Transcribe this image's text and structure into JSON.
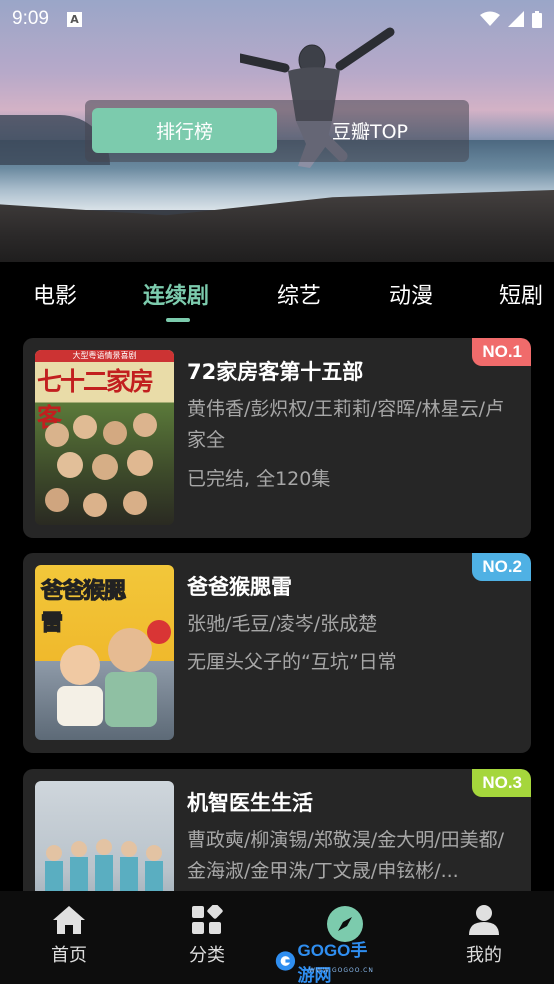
{
  "status_bar": {
    "time": "9:09",
    "notif_icon": "A"
  },
  "segments": {
    "active": "排行榜",
    "other": "豆瓣TOP"
  },
  "tabs": [
    "电影",
    "连续剧",
    "综艺",
    "动漫",
    "短剧"
  ],
  "active_tab_index": 1,
  "items": [
    {
      "rank": "NO.1",
      "badge_color": "#f06b6b",
      "title": "72家房客第十五部",
      "cast": "黄伟香/彭炽权/王莉莉/容晖/林星云/卢家全",
      "desc": "已完结, 全120集",
      "poster_title": "七十二家房客",
      "poster_top": "大型粤语情景喜剧"
    },
    {
      "rank": "NO.2",
      "badge_color": "#4fb1e4",
      "title": "爸爸猴腮雷",
      "cast": "张驰/毛豆/凌岑/张成楚",
      "desc": "无厘头父子的“互坑”日常",
      "poster_title": "爸爸猴腮雷"
    },
    {
      "rank": "NO.3",
      "badge_color": "#a5d63c",
      "title": "机智医生生活",
      "cast": "曹政奭/柳演锡/郑敬淏/金大明/田美都/金海淑/金甲洙/丁文晟/申铉彬/..."
    }
  ],
  "nav": [
    {
      "label": "首页",
      "icon": "home-icon"
    },
    {
      "label": "分类",
      "icon": "category-icon"
    },
    {
      "label": "",
      "icon": "compass-icon"
    },
    {
      "label": "我的",
      "icon": "user-icon"
    }
  ],
  "watermark": {
    "text": "GOGO手游网",
    "sub": "WWW.GOGOO.CN"
  },
  "colors": {
    "accent": "#7ccbad",
    "card_bg": "#262626",
    "muted_text": "#a7a7a7"
  }
}
